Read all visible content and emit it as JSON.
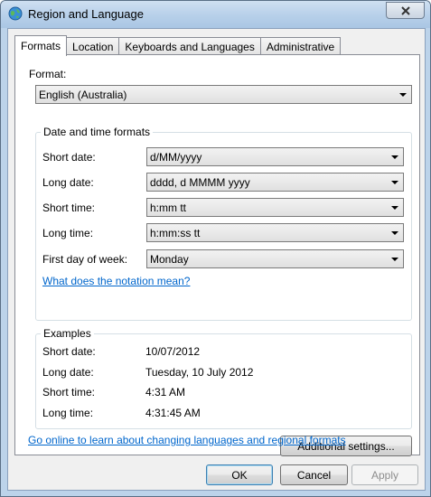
{
  "window": {
    "title": "Region and Language"
  },
  "tabs": [
    "Formats",
    "Location",
    "Keyboards and Languages",
    "Administrative"
  ],
  "format": {
    "label": "Format:",
    "value": "English (Australia)"
  },
  "datetime": {
    "group_title": "Date and time formats",
    "short_date": {
      "label": "Short date:",
      "value": "d/MM/yyyy"
    },
    "long_date": {
      "label": "Long date:",
      "value": "dddd, d MMMM yyyy"
    },
    "short_time": {
      "label": "Short time:",
      "value": "h:mm tt"
    },
    "long_time": {
      "label": "Long time:",
      "value": "h:mm:ss tt"
    },
    "first_day": {
      "label": "First day of week:",
      "value": "Monday"
    },
    "notation_link": "What does the notation mean?"
  },
  "examples": {
    "group_title": "Examples",
    "rows": [
      {
        "label": "Short date:",
        "value": "10/07/2012"
      },
      {
        "label": "Long date:",
        "value": "Tuesday, 10 July 2012"
      },
      {
        "label": "Short time:",
        "value": "4:31 AM"
      },
      {
        "label": "Long time:",
        "value": "4:31:45 AM"
      }
    ]
  },
  "additional_settings": "Additional settings...",
  "online_link": "Go online to learn about changing languages and regional formats",
  "buttons": {
    "ok": "OK",
    "cancel": "Cancel",
    "apply": "Apply"
  }
}
